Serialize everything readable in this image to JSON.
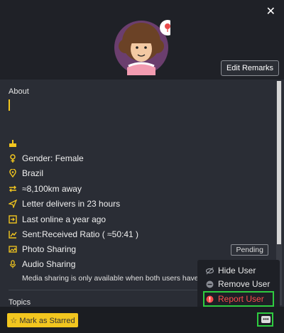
{
  "header": {
    "close_label": "✕",
    "edit_remarks": "Edit Remarks"
  },
  "about": {
    "label": "About"
  },
  "profile": {
    "gender": "Gender: Female",
    "country": "Brazil",
    "distance": "≈8,100km away",
    "delivery": "Letter delivers in 23 hours",
    "last_online": "Last online a year ago",
    "ratio": "Sent:Received Ratio ( ≈50:41 )",
    "photo_sharing": "Photo Sharing",
    "photo_status": "Pending",
    "audio_sharing": "Audio Sharing",
    "media_note": "Media sharing is only available when both users have acce"
  },
  "topics": {
    "label": "Topics"
  },
  "menu": {
    "hide_user": "Hide User",
    "remove_user": "Remove User",
    "report_user": "Report User"
  },
  "footer": {
    "star_label": "☆ Mark as Starred",
    "more_label": "•••"
  },
  "colors": {
    "accent": "#f2c61f",
    "danger": "#ff4d4d",
    "highlight": "#2ecc40",
    "panel": "#2a2d35"
  }
}
